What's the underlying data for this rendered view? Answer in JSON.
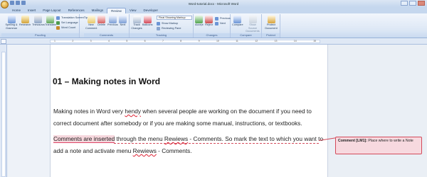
{
  "window": {
    "title": "Word-tutorial.docx - Microsoft Word"
  },
  "tabs": [
    "Home",
    "Insert",
    "Page Layout",
    "References",
    "Mailings",
    "Review",
    "View",
    "Developer"
  ],
  "active_tab": "Review",
  "ribbon": {
    "proofing": {
      "label": "Proofing",
      "spelling": "Spelling & Grammar",
      "research": "Research",
      "thesaurus": "Thesaurus",
      "translate": "Translate",
      "translation_screentip": "Translation ScreenTip",
      "set_language": "Set Language",
      "word_count": "Word Count"
    },
    "comments": {
      "label": "Comments",
      "new": "New Comment",
      "delete": "Delete",
      "previous": "Previous",
      "next": "Next"
    },
    "tracking": {
      "label": "Tracking",
      "track": "Track Changes",
      "balloons": "Balloons",
      "display_mode": "Final Showing Markup",
      "show_markup": "Show Markup",
      "reviewing_pane": "Reviewing Pane"
    },
    "changes": {
      "label": "Changes",
      "accept": "Accept",
      "reject": "Reject",
      "previous": "Previous",
      "next": "Next"
    },
    "compare": {
      "label": "Compare",
      "compare": "Compare",
      "show_source": "Show Source Documents"
    },
    "protect": {
      "label": "Protect",
      "protect_doc": "Protect Document"
    }
  },
  "ruler": {
    "numbers": [
      "1",
      "2",
      "3",
      "4",
      "5",
      "6",
      "7",
      "8",
      "9",
      "10",
      "11",
      "12",
      "13",
      "14",
      "15"
    ]
  },
  "document": {
    "heading": "01 – Making notes  in Word",
    "p1a": "Making notes in Word very ",
    "p1_typo": "hendy",
    "p1b": " when several people are working on the document if you need to",
    "p2": "correct document after somebody or if you are making some manual, instructions, or textbooks.",
    "p3_highlight": "Comments are inserted",
    "p3a": " through the menu ",
    "p3_typo": "Rewiews",
    "p3b": " - Comments. So mark the text to which you want to",
    "p4a": "add a note and activate menu ",
    "p4_typo": "Rewiews",
    "p4b": " - Comments."
  },
  "comment": {
    "author_tag": "Comment [LM1]:",
    "text": " Place where to write a Note"
  },
  "colors": {
    "comment_border": "#d34a5a",
    "comment_fill": "#f7d9df",
    "ribbon": "#dce7f5"
  }
}
